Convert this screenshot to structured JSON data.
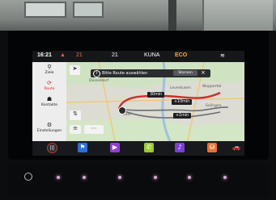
{
  "status_bar": {
    "time": "16:21",
    "temp_left": "21",
    "temp_mid": "21",
    "drive_mode": "KUNA",
    "eco_label": "ECO"
  },
  "left_rail": {
    "items": [
      {
        "label": "Ziele",
        "icon": "location-icon"
      },
      {
        "label": "Route",
        "icon": "route-icon"
      },
      {
        "label": "Kontakte",
        "icon": "contacts-icon"
      },
      {
        "label": "Einstellungen",
        "icon": "gear-icon"
      }
    ]
  },
  "banner": {
    "text": "Bitte Route auswählen",
    "cancel_label": "Stornen",
    "close_label": "×"
  },
  "map": {
    "route_tags": [
      "30min",
      "+10min",
      "+1min"
    ],
    "cities": [
      "Düsseldorf",
      "Wuppertal",
      "Köln",
      "Leverkusen",
      "Solingen"
    ]
  },
  "shortcut_bar": {
    "items": [
      "home",
      "navigation",
      "media",
      "phone",
      "voice",
      "apps",
      "car"
    ]
  }
}
